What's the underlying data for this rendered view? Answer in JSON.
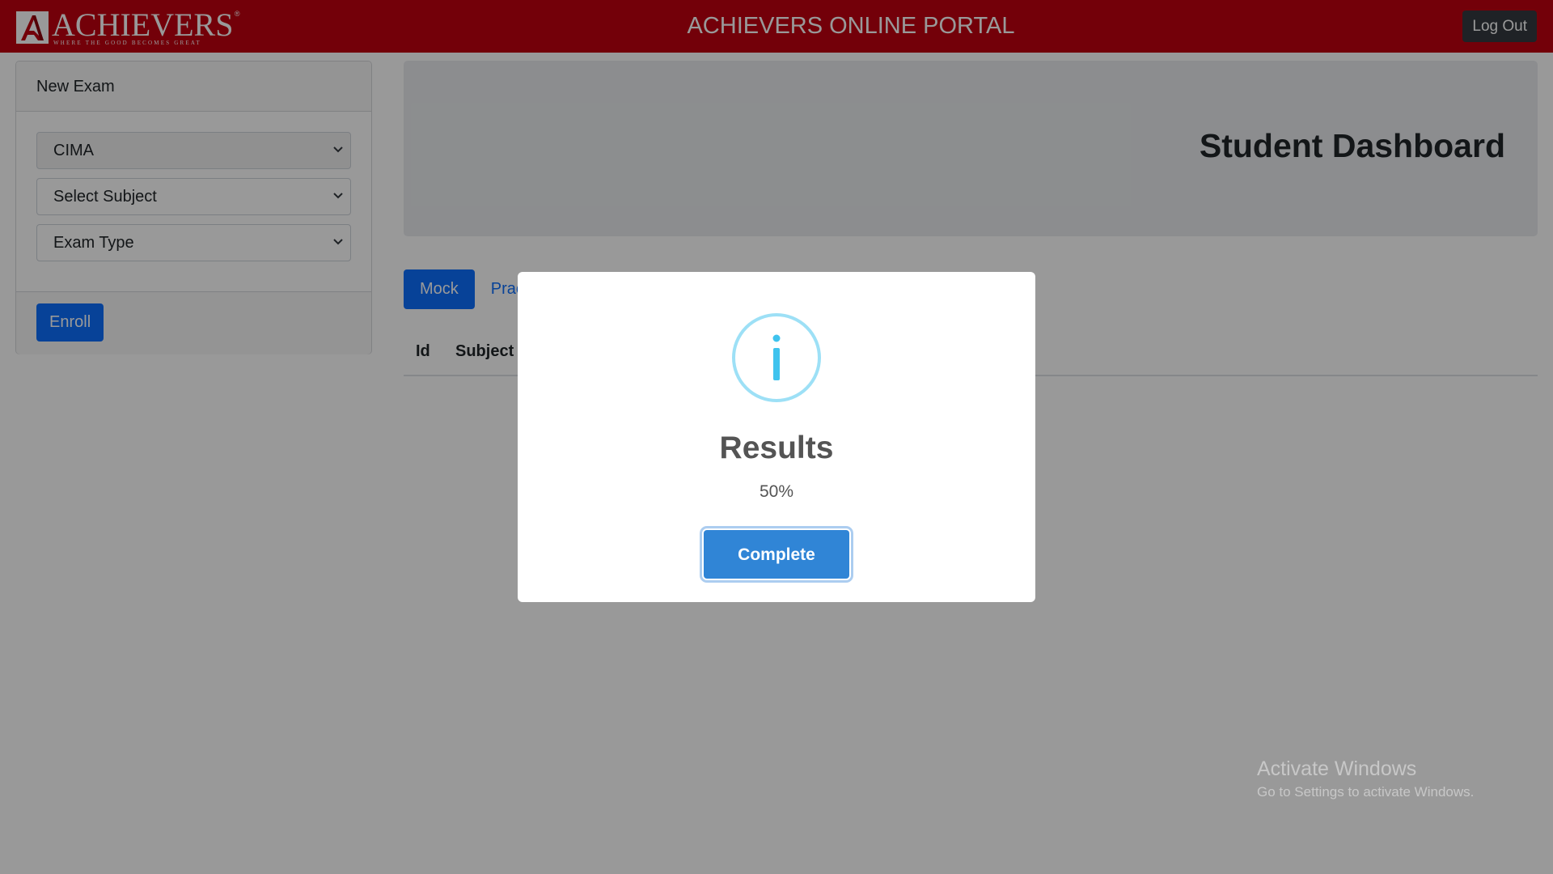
{
  "header": {
    "logo_text": "ACHIEVERS",
    "logo_tagline": "WHERE THE GOOD BECOMES GREAT",
    "logo_reg": "®",
    "title": "ACHIEVERS ONLINE PORTAL",
    "logout_label": "Log Out"
  },
  "sidebar": {
    "card_title": "New Exam",
    "selects": {
      "course": "CIMA",
      "subject": "Select Subject",
      "exam_type": "Exam Type"
    },
    "enroll_label": "Enroll"
  },
  "main": {
    "dashboard_title": "Student Dashboard",
    "tabs": {
      "mock": "Mock",
      "practice": "Prac"
    },
    "table": {
      "columns": {
        "id": "Id",
        "subject": "Subject"
      }
    }
  },
  "modal": {
    "icon": "info-icon",
    "title": "Results",
    "text": "50%",
    "confirm_label": "Complete"
  },
  "watermark": {
    "title": "Activate Windows",
    "subtitle": "Go to Settings to activate Windows."
  },
  "colors": {
    "navbar": "#c00010",
    "primary": "#0d6efd",
    "confirm": "#3085d6",
    "info": "#87d4f3",
    "logout": "#343a40"
  }
}
